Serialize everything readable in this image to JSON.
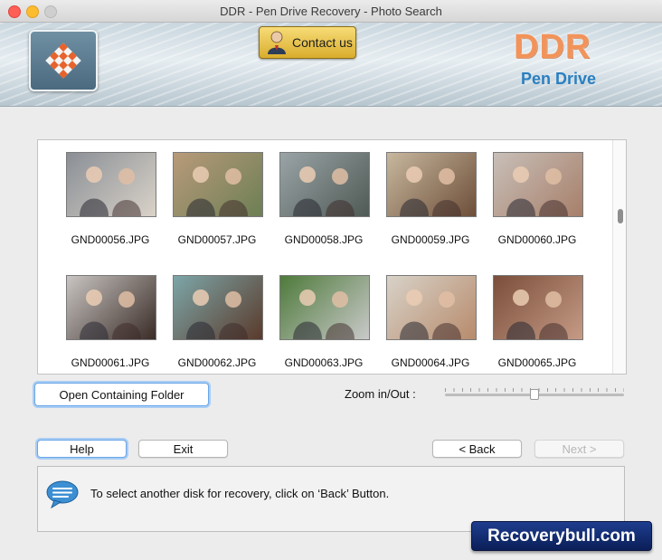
{
  "window": {
    "title": "DDR - Pen Drive Recovery - Photo Search"
  },
  "banner": {
    "contact_label": "Contact us",
    "brand_big": "DDR",
    "brand_small": "Pen Drive"
  },
  "gallery": {
    "rows": [
      [
        {
          "file": "GND00056.JPG",
          "bg": [
            "#8a8f96",
            "#d9d2c8"
          ]
        },
        {
          "file": "GND00057.JPG",
          "bg": [
            "#b89a7a",
            "#6d7f55"
          ]
        },
        {
          "file": "GND00058.JPG",
          "bg": [
            "#9aa4a7",
            "#4f5a55"
          ]
        },
        {
          "file": "GND00059.JPG",
          "bg": [
            "#c7b79e",
            "#6e4f39"
          ]
        },
        {
          "file": "GND00060.JPG",
          "bg": [
            "#c8bfb8",
            "#a77f6a"
          ]
        }
      ],
      [
        {
          "file": "GND00061.JPG",
          "bg": [
            "#c9c5c2",
            "#3a2c27"
          ]
        },
        {
          "file": "GND00062.JPG",
          "bg": [
            "#7da6a8",
            "#5a3a2b"
          ]
        },
        {
          "file": "GND00063.JPG",
          "bg": [
            "#4e7a3b",
            "#c9c9c9"
          ]
        },
        {
          "file": "GND00064.JPG",
          "bg": [
            "#d8d2c8",
            "#b78b6c"
          ]
        },
        {
          "file": "GND00065.JPG",
          "bg": [
            "#7a4e3a",
            "#c69b86"
          ]
        }
      ]
    ]
  },
  "controls": {
    "open_folder": "Open Containing Folder",
    "zoom_label": "Zoom in/Out :",
    "zoom_level": 0.5,
    "help": "Help",
    "exit": "Exit",
    "back": "< Back",
    "next": "Next >"
  },
  "info": {
    "message": "To select another disk for recovery, click on ‘Back’ Button."
  },
  "watermark": "Recoverybull.com"
}
